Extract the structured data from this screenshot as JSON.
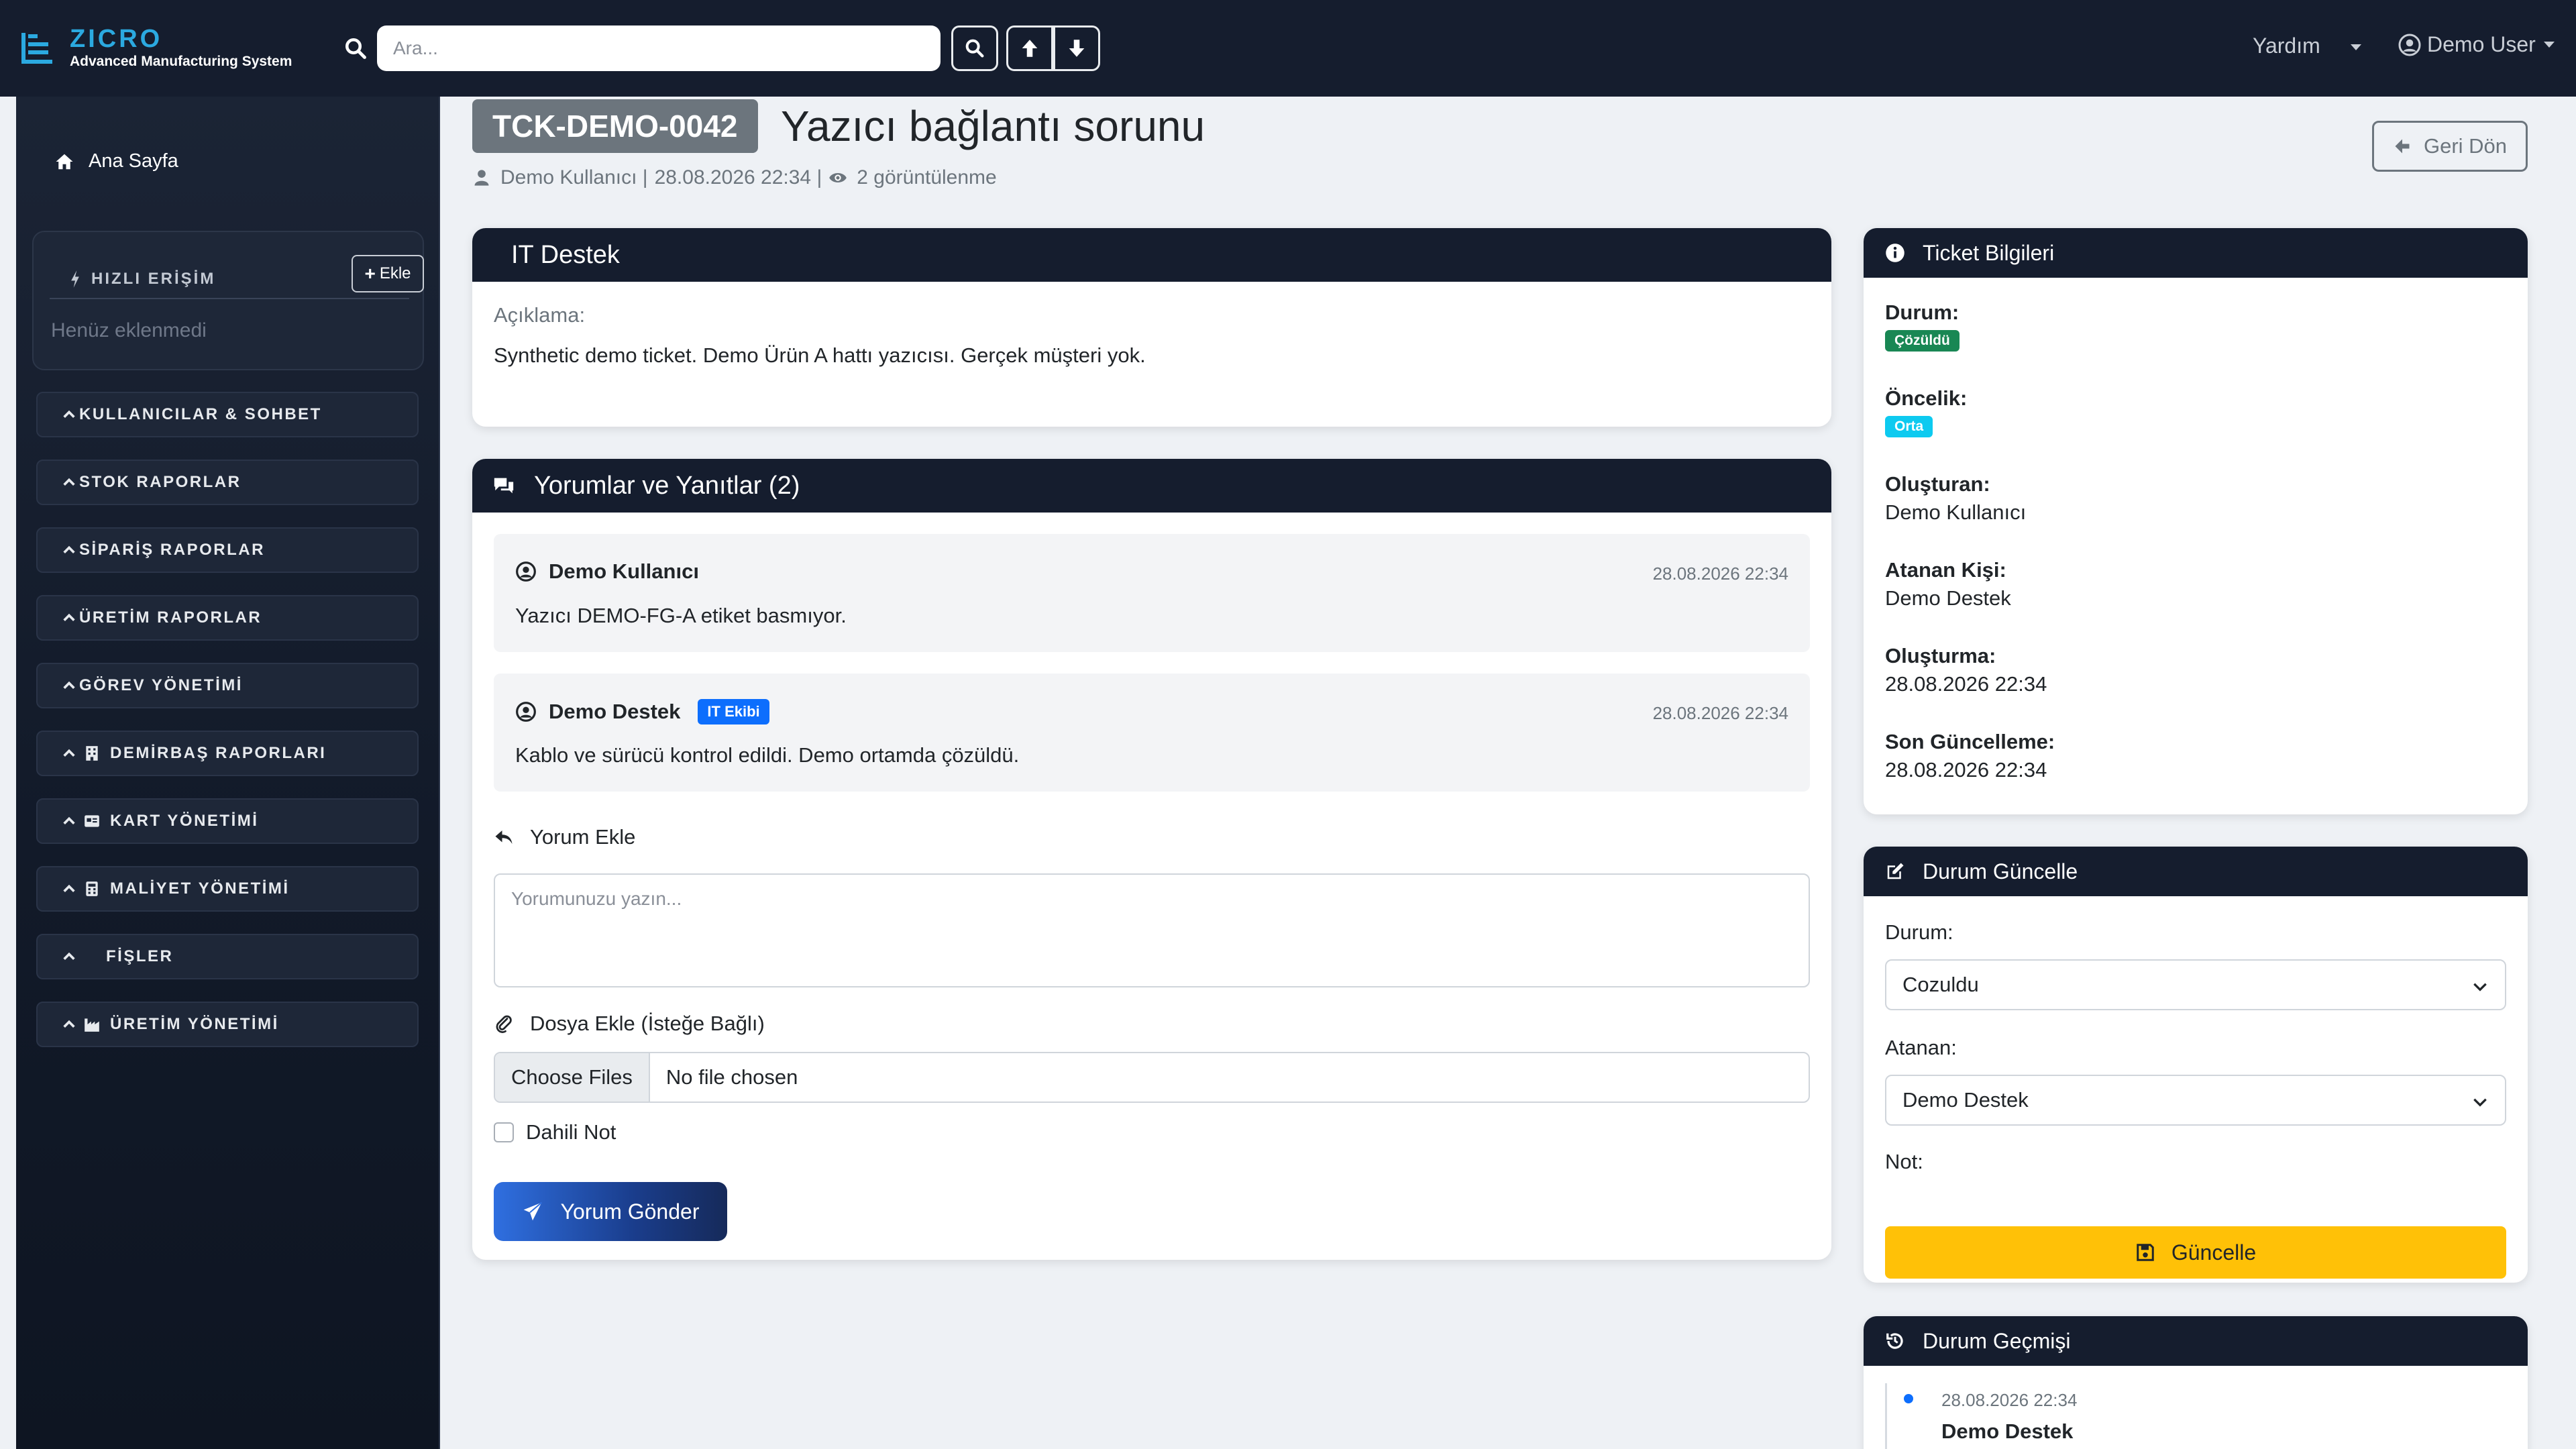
{
  "app": {
    "logo_name": "ZICRO",
    "logo_sub": "Advanced Manufacturing System",
    "search_placeholder": "Ara...",
    "help_label": "Yardım",
    "user_label": "Demo User"
  },
  "sidebar": {
    "home_label": "Ana Sayfa",
    "quick_title": "HIZLI ERİŞİM",
    "quick_add_label": "Ekle",
    "quick_empty": "Henüz eklenmedi",
    "items": [
      {
        "label": "KULLANICILAR & SOHBET",
        "icon": "none"
      },
      {
        "label": "STOK RAPORLAR",
        "icon": "none"
      },
      {
        "label": "SİPARİŞ RAPORLAR",
        "icon": "none"
      },
      {
        "label": "ÜRETİM RAPORLAR",
        "icon": "none"
      },
      {
        "label": "GÖREV YÖNETİMİ",
        "icon": "none"
      },
      {
        "label": "DEMİRBAŞ RAPORLARI",
        "icon": "building-icon"
      },
      {
        "label": "KART YÖNETİMİ",
        "icon": "card-icon"
      },
      {
        "label": "MALİYET YÖNETİMİ",
        "icon": "calculator-icon"
      },
      {
        "label": "FİŞLER",
        "icon": "none"
      },
      {
        "label": "ÜRETİM YÖNETİMİ",
        "icon": "factory-icon"
      }
    ]
  },
  "ticket": {
    "id": "TCK-DEMO-0042",
    "title": "Yazıcı bağlantı sorunu",
    "author": "Demo Kullanıcı |",
    "date": "28.08.2026 22:34 |",
    "views": "2 görüntülenme",
    "back_label": "Geri Dön"
  },
  "detail_card": {
    "header": "IT Destek",
    "desc_label": "Açıklama:",
    "desc_text": "Synthetic demo ticket. Demo Ürün A hattı yazıcısı. Gerçek müşteri yok."
  },
  "comments_card": {
    "header": "Yorumlar ve Yanıtlar (2)",
    "comments": [
      {
        "author": "Demo Kullanıcı",
        "date": "28.08.2026 22:34",
        "text": "Yazıcı DEMO-FG-A etiket basmıyor.",
        "badge": ""
      },
      {
        "author": "Demo Destek",
        "date": "28.08.2026 22:34",
        "text": "Kablo ve sürücü kontrol edildi. Demo ortamda çözüldü.",
        "badge": "IT Ekibi"
      }
    ],
    "add_title": "Yorum Ekle",
    "textarea_placeholder": "Yorumunuzu yazın...",
    "file_title": "Dosya Ekle (İsteğe Bağlı)",
    "file_button": "Choose Files",
    "file_status": "No file chosen",
    "internal_label": "Dahili Not",
    "send_label": "Yorum Gönder"
  },
  "info_card": {
    "header": "Ticket Bilgileri",
    "status_label": "Durum:",
    "status_value": "Çözüldü",
    "priority_label": "Öncelik:",
    "priority_value": "Orta",
    "creator_label": "Oluşturan:",
    "creator_value": "Demo Kullanıcı",
    "assignee_label": "Atanan Kişi:",
    "assignee_value": "Demo Destek",
    "created_label": "Oluşturma:",
    "created_value": "28.08.2026 22:34",
    "updated_label": "Son Güncelleme:",
    "updated_value": "28.08.2026 22:34"
  },
  "update_card": {
    "header": "Durum Güncelle",
    "status_label": "Durum:",
    "status_value": "Cozuldu",
    "assignee_label": "Atanan:",
    "assignee_value": "Demo Destek",
    "note_label": "Not:",
    "button_label": "Güncelle"
  },
  "history_card": {
    "header": "Durum Geçmişi",
    "entry_date": "28.08.2026 22:34",
    "entry_user": "Demo Destek"
  },
  "colors": {
    "navbar": "#151d2e",
    "accent": "#2ba9e0",
    "status_resolved": "#198754",
    "priority_medium": "#0dcaf0",
    "warning_button": "#ffc107",
    "badge_blue": "#0d6efd"
  }
}
